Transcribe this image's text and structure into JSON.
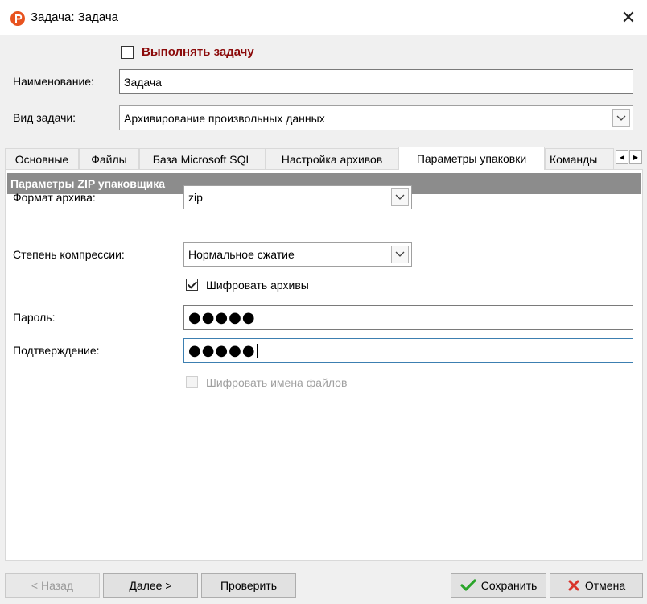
{
  "window": {
    "title": "Задача: Задача",
    "close_glyph": "✕"
  },
  "run_task": {
    "label": "Выполнять задачу",
    "checked": false
  },
  "name_field": {
    "label": "Наименование:",
    "value": "Задача"
  },
  "task_type": {
    "label": "Вид задачи:",
    "value": "Архивирование произвольных данных"
  },
  "tabs": [
    {
      "label": "Основные",
      "active": false
    },
    {
      "label": "Файлы",
      "active": false
    },
    {
      "label": "База Microsoft SQL",
      "active": false
    },
    {
      "label": "Настройка архивов",
      "active": false
    },
    {
      "label": "Параметры упаковки",
      "active": true
    },
    {
      "label": "Команды",
      "active": false
    }
  ],
  "tab_scroll": {
    "left": "◀",
    "right": "▶"
  },
  "zip_section": {
    "header": "Параметры ZIP упаковщика",
    "format": {
      "label": "Формат архива:",
      "value": "zip"
    },
    "compression": {
      "label": "Степень компрессии:",
      "value": "Нормальное сжатие"
    },
    "encrypt": {
      "label": "Шифровать архивы",
      "checked": true
    },
    "password": {
      "label": "Пароль:",
      "masked": "●●●●●"
    },
    "confirm": {
      "label": "Подтверждение:",
      "masked": "●●●●●"
    },
    "encrypt_names": {
      "label": "Шифровать имена файлов",
      "checked": false,
      "enabled": false
    }
  },
  "footer": {
    "back": "< Назад",
    "next": "Далее >",
    "check": "Проверить",
    "save": "Сохранить",
    "cancel": "Отмена"
  },
  "colors": {
    "accent_run": "#8b0a0a",
    "section_header_bg": "#8c8c8c",
    "save_icon": "#2aa52a",
    "cancel_icon": "#d9342b",
    "app_icon": "#e8531f"
  },
  "icons": {
    "app": "app-logo-icon",
    "save": "checkmark-icon",
    "cancel": "x-icon",
    "dropdown": "chevron-down-icon"
  }
}
